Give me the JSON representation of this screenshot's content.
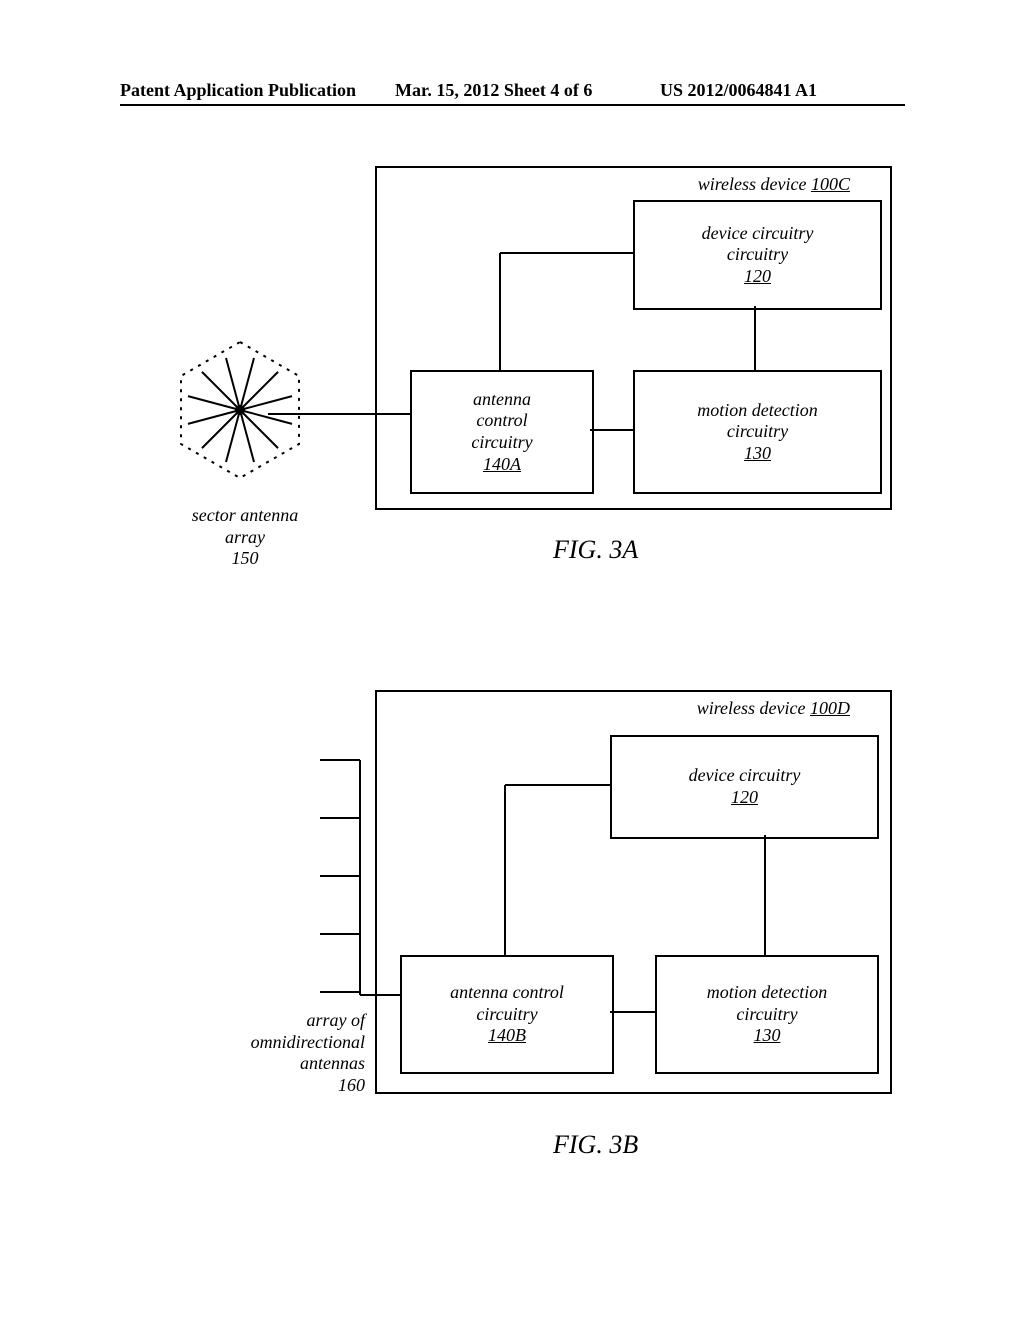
{
  "header": {
    "left": "Patent Application Publication",
    "center": "Mar. 15, 2012  Sheet 4 of 6",
    "right": "US 2012/0064841 A1"
  },
  "fig3a": {
    "device_title_prefix": "wireless device ",
    "device_title_id": "100C",
    "device_circuitry_label": "device circuitry",
    "device_circuitry_id": "120",
    "antenna_control_label_l1": "antenna",
    "antenna_control_label_l2": "control",
    "antenna_control_label_l3": "circuitry",
    "antenna_control_id": "140A",
    "motion_label_l1": "motion detection",
    "motion_label_l2": "circuitry",
    "motion_id": "130",
    "sector_label_l1": "sector antenna",
    "sector_label_l2": "array",
    "sector_id": "150",
    "caption": "FIG. 3A"
  },
  "fig3b": {
    "device_title_prefix": "wireless device ",
    "device_title_id": "100D",
    "device_circuitry_label": "device circuitry",
    "device_circuitry_id": "120",
    "antenna_control_label_l1": "antenna control",
    "antenna_control_label_l2": "circuitry",
    "antenna_control_id": "140B",
    "motion_label_l1": "motion detection",
    "motion_label_l2": "circuitry",
    "motion_id": "130",
    "array_label_l1": "array of",
    "array_label_l2": "omnidirectional",
    "array_label_l3": "antennas",
    "array_id": "160",
    "caption": "FIG. 3B"
  }
}
